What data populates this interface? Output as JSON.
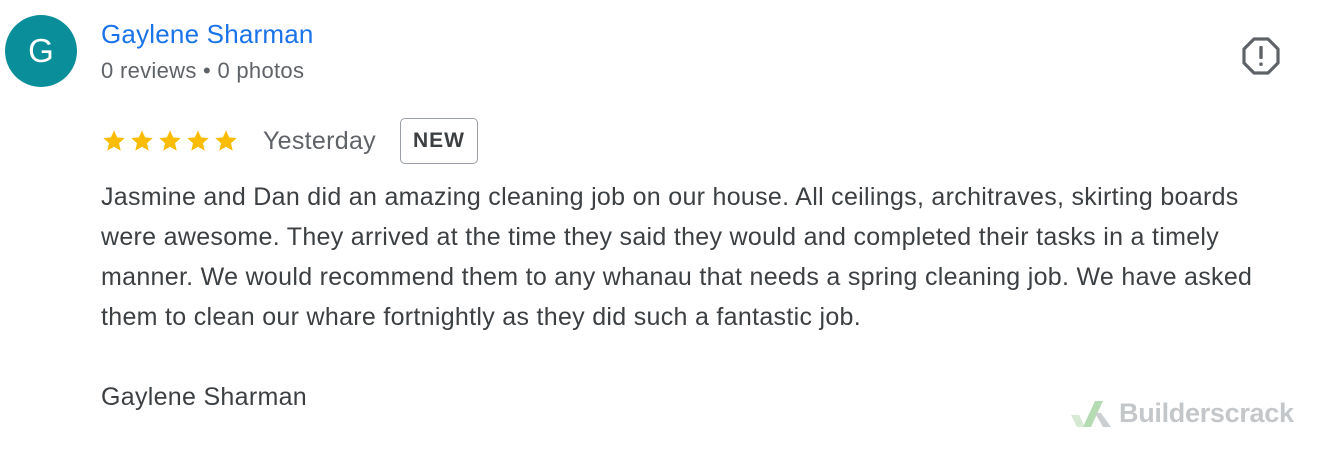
{
  "reviewer": {
    "initial": "G",
    "avatar_color": "#0a8e9a",
    "name": "Gaylene Sharman",
    "name_color": "#1a73e8",
    "meta": "0 reviews • 0 photos"
  },
  "actions": {
    "report_icon": "report-flag-icon"
  },
  "review": {
    "rating": 5,
    "rating_max": 5,
    "star_color": "#fbbc04",
    "date": "Yesterday",
    "badge": "NEW",
    "text": "Jasmine and Dan did an amazing cleaning job on our house. All ceilings, architraves, skirting boards were awesome. They arrived at the time they said they would and completed their tasks in a timely manner. We would recommend them to any whanau that needs a spring cleaning job. We have asked them to clean our whare fortnightly as they did such a fantastic job.",
    "signature": "Gaylene Sharman"
  },
  "watermark": {
    "text": "Builderscrack",
    "logo_icon": "builderscrack-logo-icon",
    "color": "#8a9097"
  }
}
